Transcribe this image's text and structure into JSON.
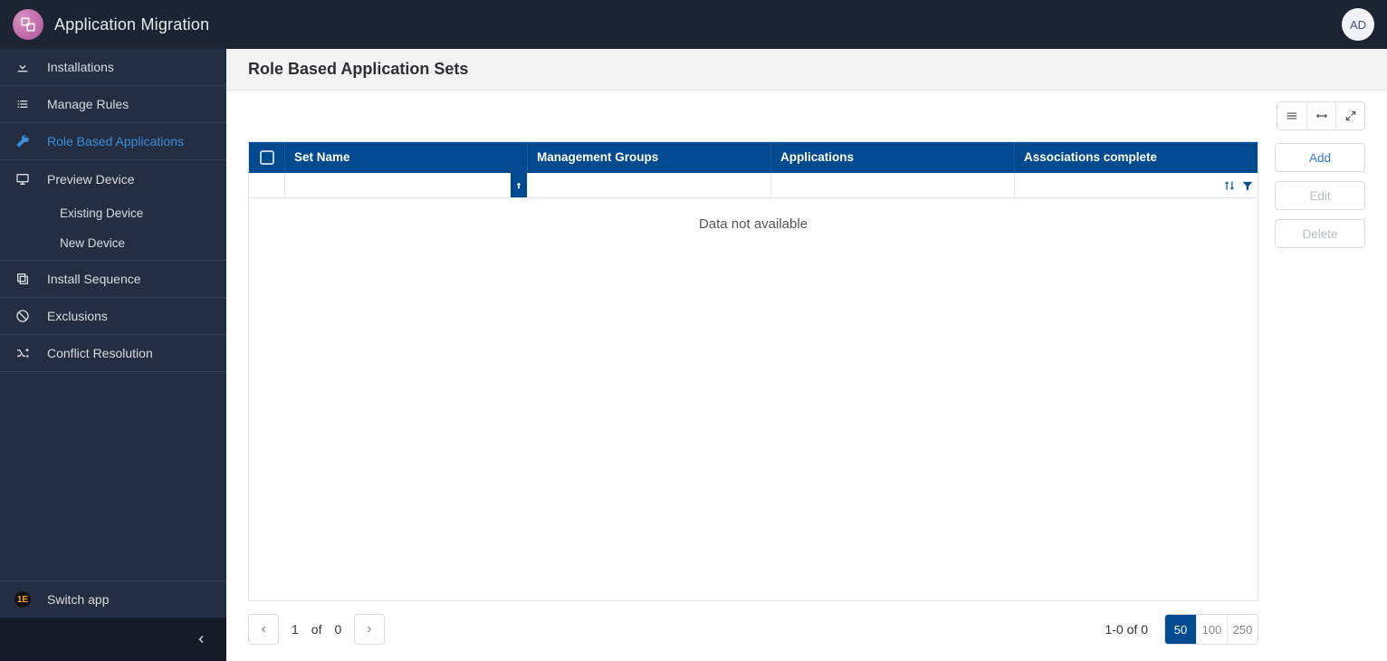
{
  "header": {
    "app_title": "Application Migration",
    "avatar_initials": "AD"
  },
  "sidebar": {
    "items": [
      {
        "label": "Installations"
      },
      {
        "label": "Manage Rules"
      },
      {
        "label": "Role Based Applications"
      },
      {
        "label": "Preview Device"
      },
      {
        "label": "Existing Device"
      },
      {
        "label": "New Device"
      },
      {
        "label": "Install Sequence"
      },
      {
        "label": "Exclusions"
      },
      {
        "label": "Conflict Resolution"
      }
    ],
    "switch_label": "Switch app"
  },
  "page": {
    "title": "Role Based Application Sets",
    "table": {
      "columns": {
        "set_name": "Set Name",
        "mg": "Management Groups",
        "apps": "Applications",
        "assoc": "Associations complete"
      },
      "empty": "Data not available"
    },
    "actions": {
      "add": "Add",
      "edit": "Edit",
      "delete": "Delete"
    },
    "pagination": {
      "current": "1",
      "of_label": "of",
      "total_pages": "0",
      "range": "1-0 of 0",
      "sizes": {
        "s50": "50",
        "s100": "100",
        "s250": "250"
      }
    }
  }
}
